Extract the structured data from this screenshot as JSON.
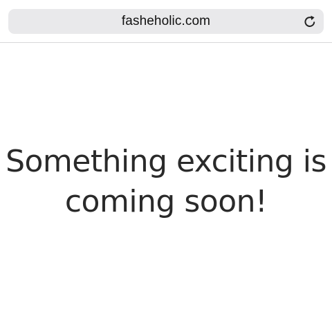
{
  "browser": {
    "url": "fasheholic.com",
    "reload_icon": "reload-icon"
  },
  "page": {
    "headline_line1": "Something exciting is",
    "headline_line2": "coming soon!"
  }
}
